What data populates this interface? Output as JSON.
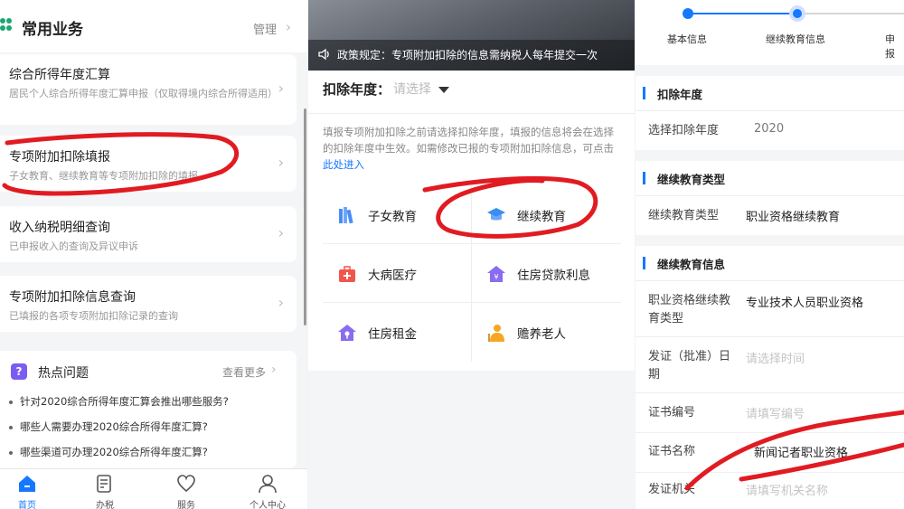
{
  "panel1": {
    "header_title": "常用业务",
    "manage_label": "管理",
    "cards": [
      {
        "title": "综合所得年度汇算",
        "desc": "居民个人综合所得年度汇算申报（仅取得境内综合所得适用）"
      },
      {
        "title": "专项附加扣除填报",
        "desc": "子女教育、继续教育等专项附加扣除的填报"
      },
      {
        "title": "收入纳税明细查询",
        "desc": "已申报收入的查询及异议申诉"
      },
      {
        "title": "专项附加扣除信息查询",
        "desc": "已填报的各项专项附加扣除记录的查询"
      }
    ],
    "hot": {
      "icon_text": "?",
      "title": "热点问题",
      "more": "查看更多",
      "questions": [
        "针对2020综合所得年度汇算会推出哪些服务?",
        "哪些人需要办理2020综合所得年度汇算?",
        "哪些渠道可办理2020综合所得年度汇算?"
      ]
    },
    "tabs": [
      {
        "label": "首页",
        "icon": "home-icon"
      },
      {
        "label": "办税",
        "icon": "document-edit-icon"
      },
      {
        "label": "服务",
        "icon": "heart-hand-icon"
      },
      {
        "label": "个人中心",
        "icon": "user-icon"
      }
    ]
  },
  "panel2": {
    "banner_text": "政策规定：专项附加扣除的信息需纳税人每年提交一次",
    "year_label": "扣除年度：",
    "year_placeholder": "请选择",
    "info_text": "填报专项附加扣除之前请选择扣除年度，填报的信息将会在选择的扣除年度中生效。如需修改已报的专项附加扣除信息，可点击",
    "info_link": "此处进入",
    "categories": [
      {
        "label": "子女教育",
        "icon": "books-icon",
        "color": "#4a8cf7"
      },
      {
        "label": "继续教育",
        "icon": "graduation-cap-icon",
        "color": "#3a8ef0"
      },
      {
        "label": "大病医疗",
        "icon": "medical-kit-icon",
        "color": "#f2564a"
      },
      {
        "label": "住房贷款利息",
        "icon": "house-yen-icon",
        "color": "#8a6cf0"
      },
      {
        "label": "住房租金",
        "icon": "house-key-icon",
        "color": "#8a6cf0"
      },
      {
        "label": "赡养老人",
        "icon": "elderly-icon",
        "color": "#f5a623"
      }
    ]
  },
  "panel3": {
    "steps": [
      "基本信息",
      "继续教育信息",
      "申报"
    ],
    "sections": [
      {
        "title": "扣除年度",
        "rows": [
          {
            "label": "选择扣除年度",
            "value": "2020",
            "placeholder": false
          }
        ]
      },
      {
        "title": "继续教育类型",
        "rows": [
          {
            "label": "继续教育类型",
            "value": "职业资格继续教育",
            "placeholder": false
          }
        ]
      },
      {
        "title": "继续教育信息",
        "rows": [
          {
            "label": "职业资格继续教育类型",
            "value": "专业技术人员职业资格",
            "placeholder": false
          },
          {
            "label": "发证（批准）日期",
            "value": "请选择时间",
            "placeholder": true
          },
          {
            "label": "证书编号",
            "value": "请填写编号",
            "placeholder": true
          },
          {
            "label": "证书名称",
            "value": "新闻记者职业资格",
            "placeholder": false
          },
          {
            "label": "发证机关",
            "value": "请填写机关名称",
            "placeholder": true
          }
        ]
      }
    ]
  },
  "colors": {
    "accent": "#1677ff",
    "annotation": "#e11b22",
    "green": "#1aa772"
  }
}
